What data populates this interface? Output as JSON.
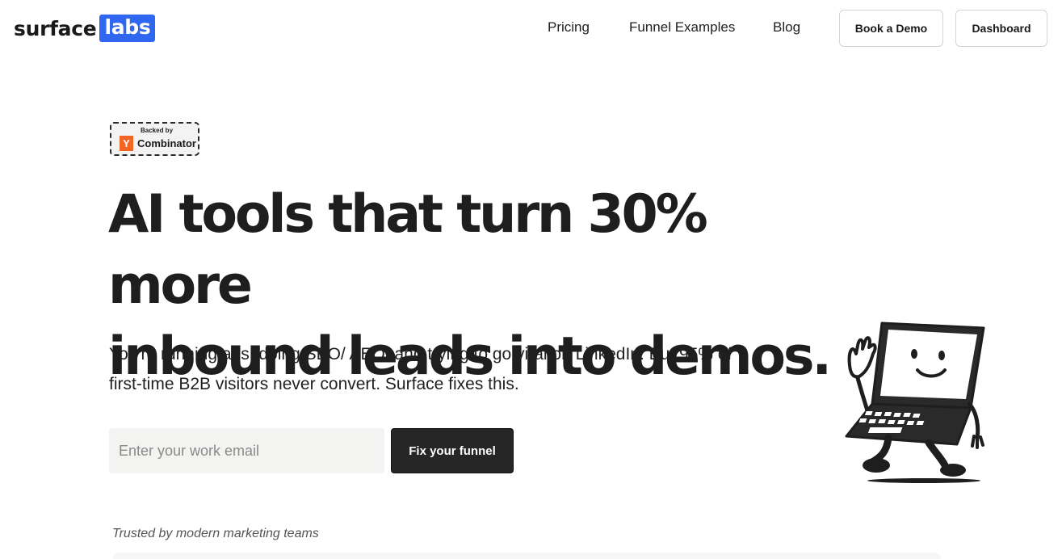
{
  "brand": {
    "word": "surface",
    "box": "labs",
    "accent": "#2f67f0"
  },
  "nav": {
    "links": [
      "Pricing",
      "Funnel Examples",
      "Blog"
    ],
    "book_demo": "Book a Demo",
    "dashboard": "Dashboard"
  },
  "badge": {
    "backed_by": "Backed by",
    "y": "Y",
    "name": "Combinator",
    "color": "#f26522"
  },
  "hero": {
    "line1": "AI tools that turn 30% more",
    "line2": "inbound leads into demos.",
    "sub1": "You're running ads, doing SEO/ AEO, and trying to go viral on LinkedIn. But 95% of",
    "sub2": "first-time B2B visitors never convert. Surface fixes this."
  },
  "form": {
    "email_placeholder": "Enter your work email",
    "email_value": "",
    "cta": "Fix your funnel"
  },
  "trusted": "Trusted by modern marketing teams",
  "mascot": {
    "icon": "laptop-mascot-icon"
  }
}
